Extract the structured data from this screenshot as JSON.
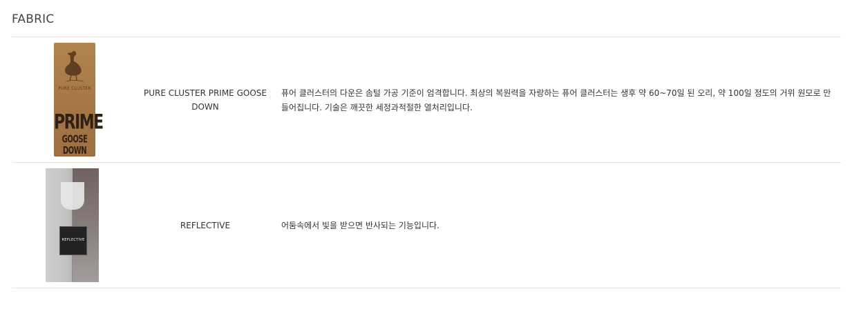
{
  "section": {
    "title": "FABRIC"
  },
  "rows": [
    {
      "name": "PURE CLUSTER PRIME GOOSE DOWN",
      "description": "퓨어 클러스터의 다운은 솜털 가공 기준이 엄격합니다. 최상의 복원력을 자랑하는 퓨어 클러스터는 생후 약 60~70일 된 오리, 약 100일 정도의 거위 원모로 만들어집니다. 기술은 깨끗한 세정과적절한 열처리입니다.",
      "image": {
        "icon": "goose-icon",
        "brand": "PURE CLUSTER",
        "big": "PRIME",
        "small": "GOOSE DOWN",
        "color": "#a87a49"
      }
    },
    {
      "name": "REFLECTIVE",
      "description": "어둠속에서 빛을 받으면 반사되는 기능입니다.",
      "image": {
        "label": "REFLECTIVE",
        "color": "#232323"
      }
    }
  ]
}
